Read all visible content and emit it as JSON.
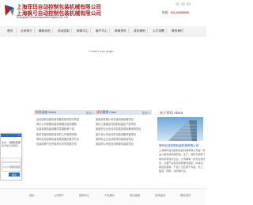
{
  "header": {
    "title_line1": "上海菲玛自动控制包装机械有限公司",
    "title_line2": "上海枫弓自动控制包装机械有限公司",
    "subtitle": "Shanghai Feima Automation  Bpack Co.,Ltd",
    "hotline_label": "热线：",
    "hotline_number": "021-64006060",
    "logo_icon": "company-logo-icon",
    "brand_color": "#b01c1c"
  },
  "nav": {
    "items": [
      "首页",
      "公司简介",
      "最新动态",
      "自动控制",
      "新闻中心",
      "客户中心",
      "新闻资讯",
      "成功案例",
      "人才招聘",
      "联系我们"
    ]
  },
  "banner": {
    "message": "Couldn't load plugin."
  },
  "news": {
    "title_prefix": "新闻",
    "title_main": "动态",
    "title_suffix": "News",
    "more": "更多>>",
    "items": [
      "自动控制包装机械设备的相关知识简述",
      "我们公司参展包装机械展览会的通知",
      "包装机械包装设备的发展趋势介绍",
      "新型包装机械包装机的工作原理说明",
      "菲玛自动控制包装机械设备的维护方法",
      "包装机械行业的现状与未来发展方向"
    ]
  },
  "cases": {
    "title_prefix": "成功",
    "title_main": "案例",
    "title_suffix": "Case",
    "more": "更多>>",
    "items": [
      "某食品有限公司包装机械设备项目",
      "某化工集团自动控制包装生产线项目",
      "某医药企业全自动包装机械设备采购项目",
      "某日化公司自动化包装设备改造项目",
      "某饲料企业自动称重包装系统项目",
      "某建材公司全自动码垛包装线项目"
    ]
  },
  "about": {
    "title_prefix": "关于",
    "title_main": "菲玛",
    "title_suffix": "About",
    "company_name": "菲玛自动控制包装机械有限公司",
    "lines": [
      "上海菲玛自动控制包装机械有限公司是一家专",
      "业从事包装机械研发、生产、销售及服务于一",
      "体的高新技术企业。公司拥有一批专业技术人",
      "员，主要产品有自动称重包装机、码垛机、",
      "输送设备等，产品广泛应用于食品、化工、",
      "医药、饲料、建材等行业。"
    ]
  },
  "popup": {
    "close": "×",
    "message_lines": [
      "您好，请您在此留言，我们",
      "会尽快与您联系，谢谢！",
      "留言咨询",
      "提交留言"
    ],
    "button": "提交"
  },
  "footer": {
    "links": [
      "首页",
      "公司简介",
      "新闻中心",
      "产品展示",
      "成功案例",
      "在线留言",
      "联系我们"
    ]
  }
}
